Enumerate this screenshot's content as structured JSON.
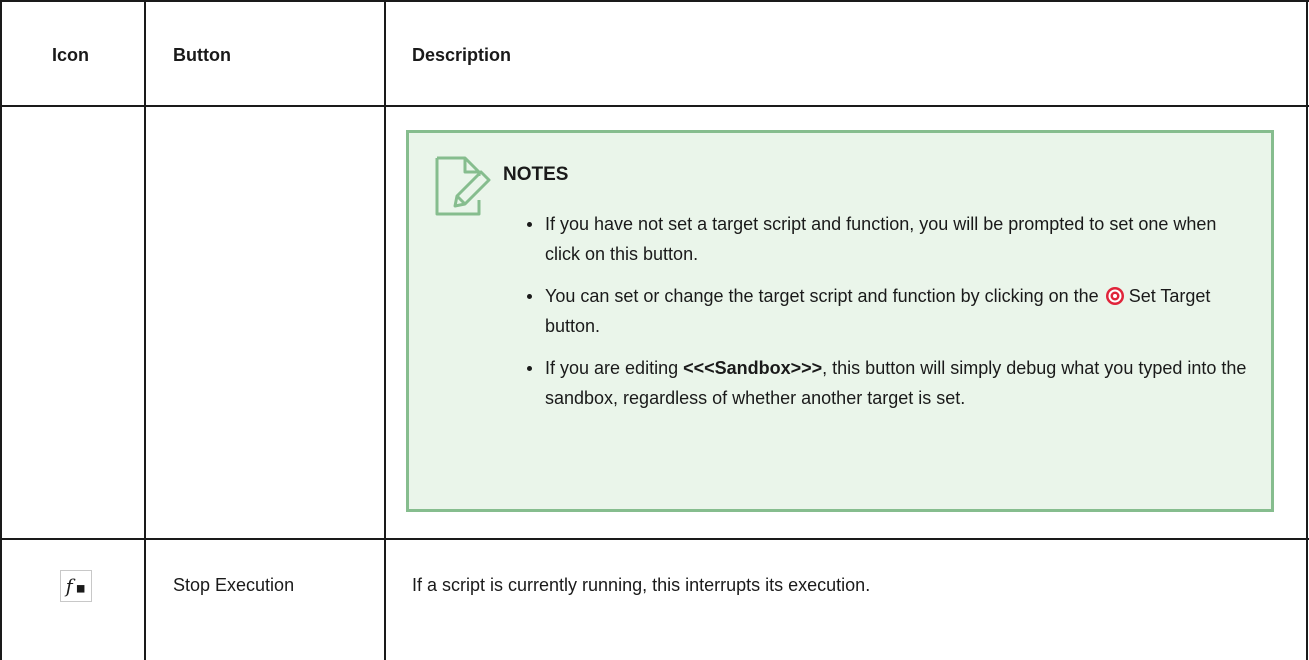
{
  "table": {
    "headers": {
      "icon": "Icon",
      "button": "Button",
      "description": "Description"
    },
    "note": {
      "title": "NOTES",
      "icon": "note-edit-icon",
      "items": [
        {
          "text": "If you have not set a target script and function, you will be prompted to set one when click on this button."
        },
        {
          "text_before": "You can set or change the target script and function by clicking on the",
          "icon": "target-icon",
          "text_after": "Set Target button."
        },
        {
          "text_before": "If you are editing ",
          "bold": "<<<Sandbox>>>",
          "text_after": ", this button will simply debug what you typed into the sandbox, regardless of whether another target is set."
        }
      ]
    },
    "rows": [
      {
        "icon": "stop-execution-icon",
        "button": "Stop Execution",
        "description": "If a script is currently running, this interrupts its execution."
      }
    ]
  },
  "colors": {
    "note_bg": "#eaf5ea",
    "note_border": "#86bd8e",
    "grid": "#1a1a1a",
    "target_red": "#e0243a"
  }
}
